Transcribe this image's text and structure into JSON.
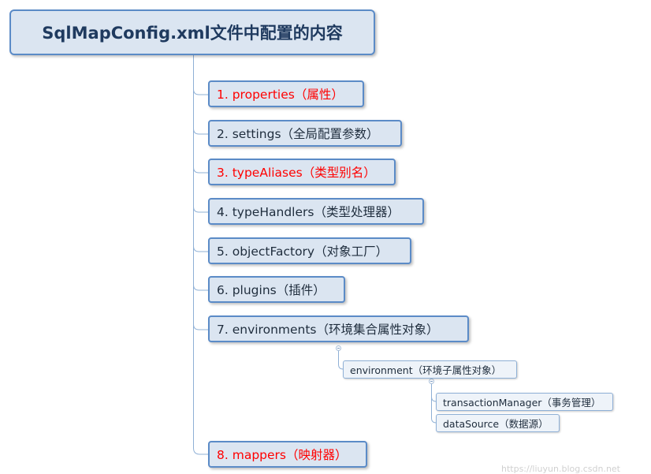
{
  "root": {
    "title": "SqlMapConfig.xml文件中配置的内容"
  },
  "items": [
    {
      "label": "1. properties（属性）",
      "highlight": true
    },
    {
      "label": "2. settings（全局配置参数）",
      "highlight": false
    },
    {
      "label": "3. typeAliases（类型别名）",
      "highlight": true
    },
    {
      "label": "4. typeHandlers（类型处理器）",
      "highlight": false
    },
    {
      "label": "5. objectFactory（对象工厂）",
      "highlight": false
    },
    {
      "label": "6. plugins（插件）",
      "highlight": false
    },
    {
      "label": "7. environments（环境集合属性对象）",
      "highlight": false
    },
    {
      "label": "8. mappers（映射器）",
      "highlight": true
    }
  ],
  "environment": {
    "label": "environment（环境子属性对象）",
    "children": [
      {
        "label": "transactionManager（事务管理）"
      },
      {
        "label": "dataSource（数据源）"
      }
    ]
  },
  "watermark": "https://liuyun.blog.csdn.net",
  "colors": {
    "highlight_text": "#ff0000",
    "node_fill": "#dbe5f1",
    "node_border": "#5b8bc7"
  }
}
